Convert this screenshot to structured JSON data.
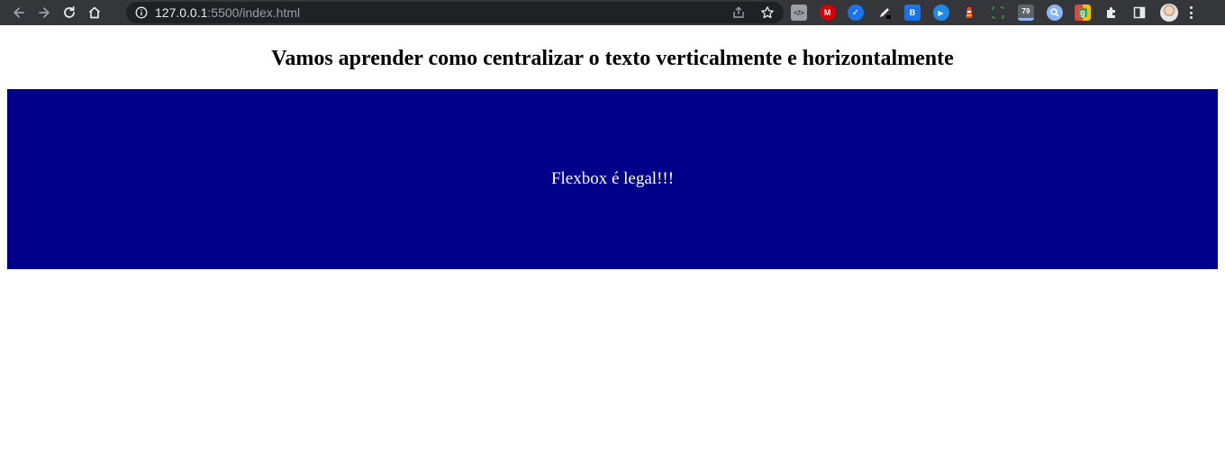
{
  "browser": {
    "url_host": "127.0.0.1",
    "url_rest": ":5500/index.html",
    "extensions": [
      {
        "icon": "code-view-extension-icon",
        "label": "</>",
        "color": "#9aa0a6"
      },
      {
        "icon": "mega-extension-icon",
        "label": "M",
        "color": "#d90007"
      },
      {
        "icon": "check-extension-icon",
        "label": "✓",
        "color": "#1a73e8"
      },
      {
        "icon": "pen-extension-icon",
        "label": "",
        "color": "#35363a"
      },
      {
        "icon": "blocks-extension-icon",
        "label": "B",
        "color": "#1a73e8"
      },
      {
        "icon": "play-extension-icon",
        "label": "▶",
        "color": "#1e88e5"
      },
      {
        "icon": "lighthouse-extension-icon",
        "label": "",
        "color": "#e8472b"
      },
      {
        "icon": "screenshot-extension-icon",
        "label": "",
        "color": "#35363a"
      },
      {
        "icon": "counter-extension-icon",
        "label": "79",
        "color": "#5f6368"
      },
      {
        "icon": "search-extension-icon",
        "label": "",
        "color": "#8ab4f8"
      },
      {
        "icon": "google-extension-icon",
        "label": "g",
        "color": "#34a853"
      },
      {
        "icon": "puzzle-icon",
        "label": "",
        "color": "#35363a"
      },
      {
        "icon": "side-panel-icon",
        "label": "",
        "color": "#35363a"
      }
    ]
  },
  "page": {
    "title": "Vamos aprender como centralizar o texto verticalmente e horizontalmente",
    "box_text": "Flexbox é legal!!!",
    "box_color": "#00008b"
  }
}
